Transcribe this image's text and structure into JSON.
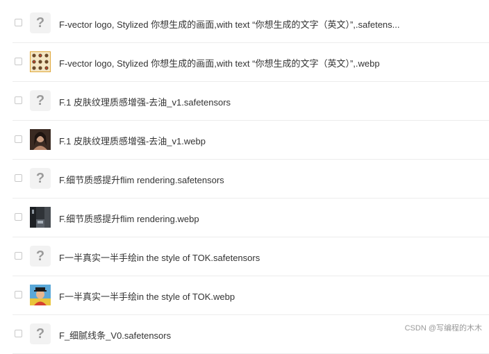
{
  "files": [
    {
      "name": "F-vector logo, Stylized 你想生成的画面,with text “你想生成的文字（英文）”,.safetens...",
      "thumb": "question-mark"
    },
    {
      "name": "F-vector logo, Stylized 你想生成的画面,with text “你想生成的文字（英文）”,.webp",
      "thumb": "image-logo-grid"
    },
    {
      "name": "F.1 皮肤纹理质感增强-去油_v1.safetensors",
      "thumb": "question-mark"
    },
    {
      "name": "F.1 皮肤纹理质感增强-去油_v1.webp",
      "thumb": "image-portrait"
    },
    {
      "name": "F.细节质感提升flim rendering.safetensors",
      "thumb": "question-mark"
    },
    {
      "name": "F.细节质感提升flim rendering.webp",
      "thumb": "image-street"
    },
    {
      "name": "F一半真实一半手绘in the style of TOK.safetensors",
      "thumb": "question-mark"
    },
    {
      "name": "F一半真实一半手绘in the style of TOK.webp",
      "thumb": "image-cartoon"
    },
    {
      "name": "F_细腻线条_V0.safetensors",
      "thumb": "question-mark"
    }
  ],
  "placeholder_glyph": "?",
  "watermark": "CSDN @写编程的木木"
}
